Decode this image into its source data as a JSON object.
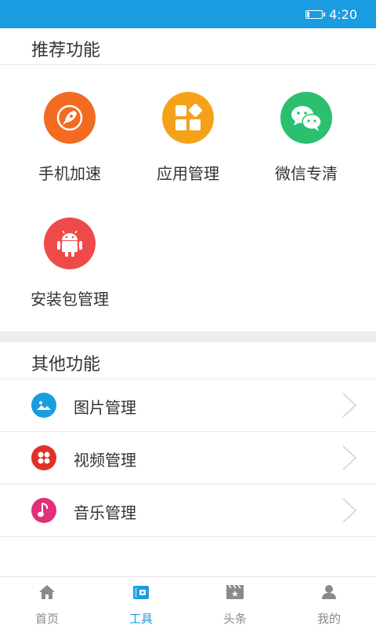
{
  "status_bar": {
    "time": "4:20",
    "battery_level": 0.2
  },
  "recommended": {
    "title": "推荐功能",
    "items": [
      {
        "label": "手机加速",
        "icon": "rocket-icon",
        "color": "#f26b21"
      },
      {
        "label": "应用管理",
        "icon": "apps-grid-icon",
        "color": "#f5a21b"
      },
      {
        "label": "微信专清",
        "icon": "wechat-icon",
        "color": "#2bbf6f"
      },
      {
        "label": "安装包管理",
        "icon": "android-icon",
        "color": "#ef4a4a"
      }
    ]
  },
  "other": {
    "title": "其他功能",
    "items": [
      {
        "label": "图片管理",
        "icon": "picture-icon",
        "color": "#1a9de0"
      },
      {
        "label": "视频管理",
        "icon": "film-reel-icon",
        "color": "#e03127"
      },
      {
        "label": "音乐管理",
        "icon": "music-note-icon",
        "color": "#e0307a"
      }
    ]
  },
  "bottom_nav": {
    "active_index": 1,
    "active_color": "#1a9de0",
    "items": [
      {
        "label": "首页",
        "icon": "home-icon"
      },
      {
        "label": "工具",
        "icon": "toolbox-icon"
      },
      {
        "label": "头条",
        "icon": "clapperboard-icon"
      },
      {
        "label": "我的",
        "icon": "person-icon"
      }
    ]
  }
}
